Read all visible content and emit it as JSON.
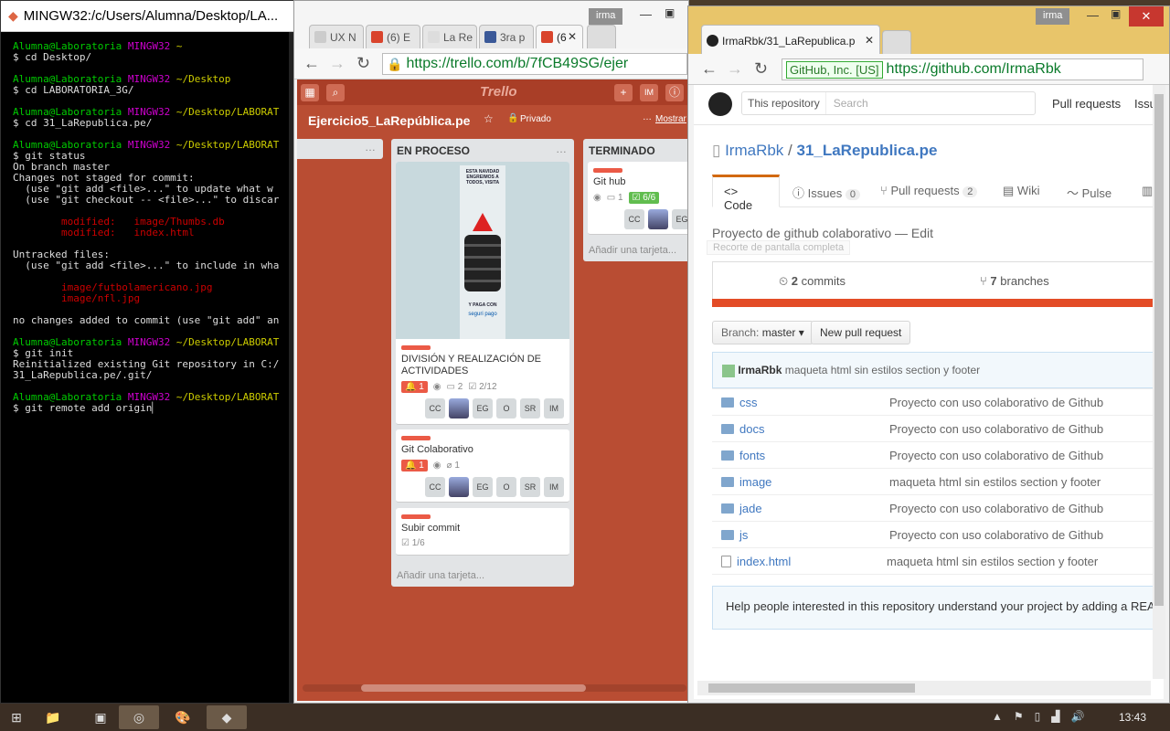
{
  "terminal": {
    "title": "MINGW32:/c/Users/Alumna/Desktop/LA...",
    "lines": [
      [
        [
          "Alumna@Laboratoria ",
          "gr"
        ],
        [
          "MINGW32",
          "mg"
        ],
        [
          " ~",
          "yl"
        ]
      ],
      [
        [
          "$ cd Desktop/",
          "wh"
        ]
      ],
      [
        [
          "",
          ""
        ]
      ],
      [
        [
          "Alumna@Laboratoria ",
          "gr"
        ],
        [
          "MINGW32",
          "mg"
        ],
        [
          " ~/Desktop",
          "yl"
        ]
      ],
      [
        [
          "$ cd LABORATORIA_3G/",
          "wh"
        ]
      ],
      [
        [
          "",
          ""
        ]
      ],
      [
        [
          "Alumna@Laboratoria ",
          "gr"
        ],
        [
          "MINGW32",
          "mg"
        ],
        [
          " ~/Desktop/LABORAT",
          "yl"
        ]
      ],
      [
        [
          "$ cd 31_LaRepublica.pe/",
          "wh"
        ]
      ],
      [
        [
          "",
          ""
        ]
      ],
      [
        [
          "Alumna@Laboratoria ",
          "gr"
        ],
        [
          "MINGW32",
          "mg"
        ],
        [
          " ~/Desktop/LABORAT",
          "yl"
        ]
      ],
      [
        [
          "$ git status",
          "wh"
        ]
      ],
      [
        [
          "On branch master",
          "wh"
        ]
      ],
      [
        [
          "Changes not staged for commit:",
          "wh"
        ]
      ],
      [
        [
          "  (use \"git add <file>...\" to update what w",
          "wh"
        ]
      ],
      [
        [
          "  (use \"git checkout -- <file>...\" to discar",
          "wh"
        ]
      ],
      [
        [
          "",
          ""
        ]
      ],
      [
        [
          "        modified:   image/Thumbs.db",
          "rd"
        ]
      ],
      [
        [
          "        modified:   index.html",
          "rd"
        ]
      ],
      [
        [
          "",
          ""
        ]
      ],
      [
        [
          "Untracked files:",
          "wh"
        ]
      ],
      [
        [
          "  (use \"git add <file>...\" to include in wha",
          "wh"
        ]
      ],
      [
        [
          "",
          ""
        ]
      ],
      [
        [
          "        image/futbolamericano.jpg",
          "rd"
        ]
      ],
      [
        [
          "        image/nfl.jpg",
          "rd"
        ]
      ],
      [
        [
          "",
          ""
        ]
      ],
      [
        [
          "no changes added to commit (use \"git add\" an",
          "wh"
        ]
      ],
      [
        [
          "",
          ""
        ]
      ],
      [
        [
          "Alumna@Laboratoria ",
          "gr"
        ],
        [
          "MINGW32",
          "mg"
        ],
        [
          " ~/Desktop/LABORAT",
          "yl"
        ]
      ],
      [
        [
          "$ git init",
          "wh"
        ]
      ],
      [
        [
          "Reinitialized existing Git repository in C:/",
          "wh"
        ]
      ],
      [
        [
          "31_LaRepublica.pe/.git/",
          "wh"
        ]
      ],
      [
        [
          "",
          ""
        ]
      ],
      [
        [
          "Alumna@Laboratoria ",
          "gr"
        ],
        [
          "MINGW32",
          "mg"
        ],
        [
          " ~/Desktop/LABORAT",
          "yl"
        ]
      ],
      [
        [
          "$ git remote add origin",
          "wh"
        ]
      ]
    ]
  },
  "trello_window": {
    "user": "irma",
    "tabs": [
      "UX N",
      "(6) E",
      "La Re",
      "3ra p",
      "(6"
    ],
    "url": "https://trello.com/b/7fCB49SG/ejer",
    "logo": "Trello",
    "initials": "IM",
    "board_title": "Ejercicio5_LaRepública.pe",
    "visibility": "Privado",
    "show_menu": "Mostrar",
    "lists": {
      "en_proceso": {
        "title": "EN PROCESO",
        "add": "Añadir una tarjeta..."
      },
      "terminado": {
        "title": "TERMINADO",
        "add": "Añadir una tarjeta..."
      }
    },
    "cards": {
      "c1": {
        "title": "DIVISIÓN Y REALIZACIÓN DE ACTIVIDADES",
        "alert": "1",
        "comments": "2",
        "checklist": "2/12",
        "members": [
          "CC",
          "",
          "EG",
          "O",
          "SR",
          "IM"
        ]
      },
      "c2": {
        "title": "Git Colaborativo",
        "alert": "1",
        "attach": "1",
        "members": [
          "CC",
          "",
          "EG",
          "O",
          "SR",
          "IM"
        ]
      },
      "c3": {
        "title": "Subir commit",
        "checklist": "1/6"
      },
      "c4": {
        "title": "Git hub",
        "comments": "1",
        "checklist": "6/6",
        "members": [
          "CC",
          "",
          "EG"
        ]
      }
    },
    "cover_text": {
      "top": "ESTA NAVIDAD ENGREIMOS A TODOS, VISITA",
      "mid": "Y PAGA CON",
      "brand": "seguri pago"
    }
  },
  "github_window": {
    "user": "irma",
    "tab_title": "IrmaRbk/31_LaRepublica.p",
    "security": "GitHub, Inc. [US]",
    "url": "https://github.com/IrmaRbk",
    "search_scope": "This repository",
    "search_placeholder": "Search",
    "nav_pull": "Pull requests",
    "nav_issues": "Issue",
    "owner": "IrmaRbk",
    "repo": "31_LaRepublica.pe",
    "tabs": {
      "code": "Code",
      "issues": "Issues",
      "issues_count": "0",
      "pulls": "Pull requests",
      "pulls_count": "2",
      "wiki": "Wiki",
      "pulse": "Pulse"
    },
    "description": "Proyecto de github colaborativo",
    "edit": "— Edit",
    "tooltip": "Recorte de pantalla completa",
    "commits_num": "2",
    "commits_label": "commits",
    "branches_num": "7",
    "branches_label": "branches",
    "branch_label": "Branch:",
    "branch_value": "master",
    "new_pr": "New pull request",
    "last_commit_author": "IrmaRbk",
    "last_commit_msg": "maqueta html sin estilos section y footer",
    "files": [
      {
        "name": "css",
        "msg": "Proyecto con uso colaborativo de Github",
        "type": "dir"
      },
      {
        "name": "docs",
        "msg": "Proyecto con uso colaborativo de Github",
        "type": "dir"
      },
      {
        "name": "fonts",
        "msg": "Proyecto con uso colaborativo de Github",
        "type": "dir"
      },
      {
        "name": "image",
        "msg": "maqueta html sin estilos section y footer",
        "type": "dir"
      },
      {
        "name": "jade",
        "msg": "Proyecto con uso colaborativo de Github",
        "type": "dir"
      },
      {
        "name": "js",
        "msg": "Proyecto con uso colaborativo de Github",
        "type": "dir"
      },
      {
        "name": "index.html",
        "msg": "maqueta html sin estilos section y footer",
        "type": "file"
      }
    ],
    "readme_hint": "Help people interested in this repository understand your project by adding a READI"
  },
  "taskbar": {
    "time": "13:43"
  }
}
